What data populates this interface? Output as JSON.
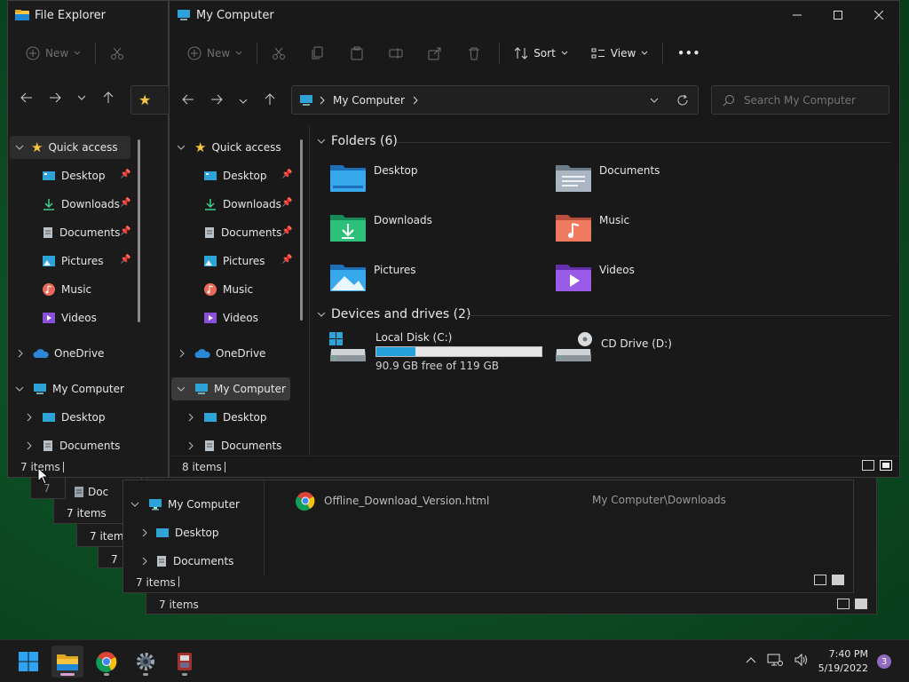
{
  "background_windows": {
    "status_7items": "7 items",
    "partial_doc": "Doc",
    "partial_7": "7",
    "partial_7b": "7 items",
    "partial_7c": "7 items",
    "lower_window": {
      "nav": [
        {
          "label": "My Computer",
          "icon": "monitor-icon",
          "expanded": true
        },
        {
          "label": "Desktop",
          "icon": "desktop-icon"
        },
        {
          "label": "Documents",
          "icon": "documents-icon"
        }
      ],
      "file_name": "Offline_Download_Version.html",
      "file_location": "My Computer\\Downloads",
      "status": "7 items"
    },
    "bottom_status": "7 items"
  },
  "left_window": {
    "title": "File Explorer",
    "new_label": "New",
    "status": "7 items",
    "nav": [
      {
        "label": "Quick access",
        "icon": "star-icon",
        "expanded": true
      },
      {
        "label": "Desktop",
        "icon": "desktop-icon",
        "pinned": true
      },
      {
        "label": "Downloads",
        "icon": "download-icon",
        "pinned": true
      },
      {
        "label": "Documents",
        "icon": "documents-icon",
        "pinned": true
      },
      {
        "label": "Pictures",
        "icon": "pictures-icon",
        "pinned": true
      },
      {
        "label": "Music",
        "icon": "music-icon"
      },
      {
        "label": "Videos",
        "icon": "videos-icon"
      },
      {
        "label": "OneDrive",
        "icon": "cloud-icon"
      },
      {
        "label": "My Computer",
        "icon": "monitor-icon",
        "expanded": true
      },
      {
        "label": "Desktop",
        "icon": "desktop-icon"
      },
      {
        "label": "Documents",
        "icon": "documents-icon"
      }
    ]
  },
  "main_window": {
    "title": "My Computer",
    "toolbar": {
      "new_label": "New",
      "sort_label": "Sort",
      "view_label": "View",
      "more_label": "•••"
    },
    "address": {
      "path": "My Computer",
      "search_placeholder": "Search My Computer"
    },
    "nav": [
      {
        "label": "Quick access",
        "icon": "star-icon",
        "expanded": true
      },
      {
        "label": "Desktop",
        "icon": "desktop-icon",
        "pinned": true
      },
      {
        "label": "Downloads",
        "icon": "download-icon",
        "pinned": true
      },
      {
        "label": "Documents",
        "icon": "documents-icon",
        "pinned": true
      },
      {
        "label": "Pictures",
        "icon": "pictures-icon",
        "pinned": true
      },
      {
        "label": "Music",
        "icon": "music-icon"
      },
      {
        "label": "Videos",
        "icon": "videos-icon"
      },
      {
        "label": "OneDrive",
        "icon": "cloud-icon"
      },
      {
        "label": "My Computer",
        "icon": "monitor-icon",
        "expanded": true,
        "selected": true
      },
      {
        "label": "Desktop",
        "icon": "desktop-icon"
      },
      {
        "label": "Documents",
        "icon": "documents-icon"
      }
    ],
    "folders_header": "Folders (6)",
    "folders": [
      {
        "label": "Desktop",
        "icon": "desktop-folder-icon"
      },
      {
        "label": "Documents",
        "icon": "documents-folder-icon"
      },
      {
        "label": "Downloads",
        "icon": "downloads-folder-icon"
      },
      {
        "label": "Music",
        "icon": "music-folder-icon"
      },
      {
        "label": "Pictures",
        "icon": "pictures-folder-icon"
      },
      {
        "label": "Videos",
        "icon": "videos-folder-icon"
      }
    ],
    "drives_header": "Devices and drives (2)",
    "drives": [
      {
        "label": "Local Disk (C:)",
        "free_text": "90.9 GB free of 119 GB",
        "used_fraction": 0.236
      },
      {
        "label": "CD Drive (D:)"
      }
    ],
    "status": "8 items"
  },
  "taskbar": {
    "time": "7:40 PM",
    "date": "5/19/2022",
    "notification_count": "3"
  },
  "colors": {
    "accent": "#0078d4",
    "drive_bar": "#26a0da",
    "badge": "#8e6bbf"
  }
}
